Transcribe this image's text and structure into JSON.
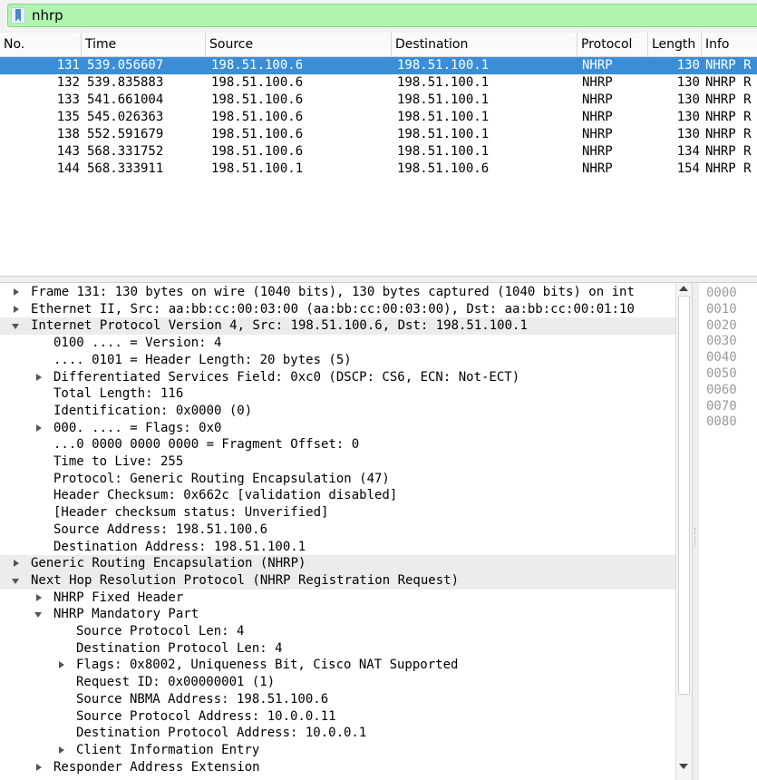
{
  "filter": {
    "value": "nhrp"
  },
  "packet_list": {
    "columns": [
      "No.",
      "Time",
      "Source",
      "Destination",
      "Protocol",
      "Length",
      "Info"
    ],
    "rows": [
      {
        "no": "131",
        "time": "539.056607",
        "source": "198.51.100.6",
        "destination": "198.51.100.1",
        "protocol": "NHRP",
        "length": "130",
        "info": "NHRP R"
      },
      {
        "no": "132",
        "time": "539.835883",
        "source": "198.51.100.6",
        "destination": "198.51.100.1",
        "protocol": "NHRP",
        "length": "130",
        "info": "NHRP R"
      },
      {
        "no": "133",
        "time": "541.661004",
        "source": "198.51.100.6",
        "destination": "198.51.100.1",
        "protocol": "NHRP",
        "length": "130",
        "info": "NHRP R"
      },
      {
        "no": "135",
        "time": "545.026363",
        "source": "198.51.100.6",
        "destination": "198.51.100.1",
        "protocol": "NHRP",
        "length": "130",
        "info": "NHRP R"
      },
      {
        "no": "138",
        "time": "552.591679",
        "source": "198.51.100.6",
        "destination": "198.51.100.1",
        "protocol": "NHRP",
        "length": "130",
        "info": "NHRP R"
      },
      {
        "no": "143",
        "time": "568.331752",
        "source": "198.51.100.6",
        "destination": "198.51.100.1",
        "protocol": "NHRP",
        "length": "134",
        "info": "NHRP R"
      },
      {
        "no": "144",
        "time": "568.333911",
        "source": "198.51.100.1",
        "destination": "198.51.100.6",
        "protocol": "NHRP",
        "length": "154",
        "info": "NHRP R"
      }
    ]
  },
  "details": {
    "rows": [
      {
        "text": "Frame 131: 130 bytes on wire (1040 bits), 130 bytes captured (1040 bits) on int"
      },
      {
        "text": "Ethernet II, Src: aa:bb:cc:00:03:00 (aa:bb:cc:00:03:00), Dst: aa:bb:cc:00:01:10"
      },
      {
        "text": "Internet Protocol Version 4, Src: 198.51.100.6, Dst: 198.51.100.1"
      },
      {
        "text": "0100 .... = Version: 4"
      },
      {
        "text": ".... 0101 = Header Length: 20 bytes (5)"
      },
      {
        "text": "Differentiated Services Field: 0xc0 (DSCP: CS6, ECN: Not-ECT)"
      },
      {
        "text": "Total Length: 116"
      },
      {
        "text": "Identification: 0x0000 (0)"
      },
      {
        "text": "000. .... = Flags: 0x0"
      },
      {
        "text": "...0 0000 0000 0000 = Fragment Offset: 0"
      },
      {
        "text": "Time to Live: 255"
      },
      {
        "text": "Protocol: Generic Routing Encapsulation (47)"
      },
      {
        "text": "Header Checksum: 0x662c [validation disabled]"
      },
      {
        "text": "[Header checksum status: Unverified]"
      },
      {
        "text": "Source Address: 198.51.100.6"
      },
      {
        "text": "Destination Address: 198.51.100.1"
      },
      {
        "text": "Generic Routing Encapsulation (NHRP)"
      },
      {
        "text": "Next Hop Resolution Protocol (NHRP Registration Request)"
      },
      {
        "text": "NHRP Fixed Header"
      },
      {
        "text": "NHRP Mandatory Part"
      },
      {
        "text": "Source Protocol Len: 4"
      },
      {
        "text": "Destination Protocol Len: 4"
      },
      {
        "text": "Flags: 0x8002, Uniqueness Bit, Cisco NAT Supported"
      },
      {
        "text": "Request ID: 0x00000001 (1)"
      },
      {
        "text": "Source NBMA Address: 198.51.100.6"
      },
      {
        "text": "Source Protocol Address: 10.0.0.11"
      },
      {
        "text": "Destination Protocol Address: 10.0.0.1"
      },
      {
        "text": "Client Information Entry"
      },
      {
        "text": "Responder Address Extension"
      }
    ]
  },
  "bytes": {
    "offsets": [
      "0000",
      "0010",
      "0020",
      "0030",
      "0040",
      "0050",
      "0060",
      "0070",
      "0080"
    ]
  }
}
